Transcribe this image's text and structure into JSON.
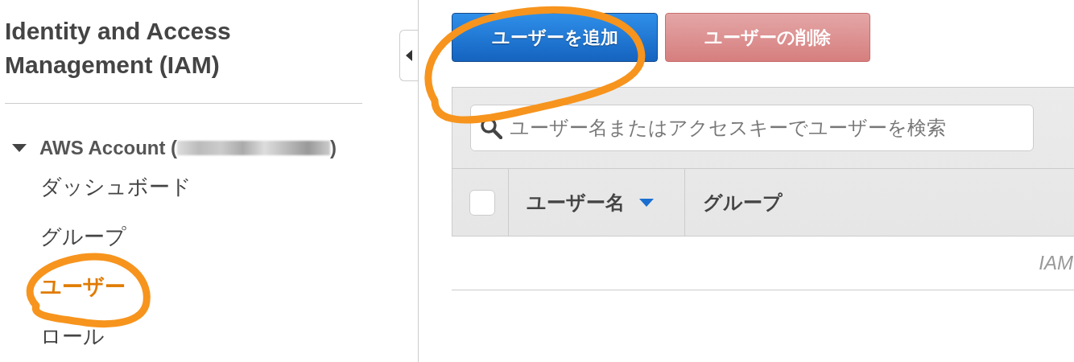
{
  "sidebar": {
    "title": "Identity and Access Management (IAM)",
    "account": {
      "label_start": "AWS Account (",
      "label_end": ")",
      "expanded": true
    },
    "items": [
      {
        "label": "ダッシュボード",
        "selected": false
      },
      {
        "label": "グループ",
        "selected": false
      },
      {
        "label": "ユーザー",
        "selected": true
      },
      {
        "label": "ロール",
        "selected": false
      }
    ]
  },
  "toolbar": {
    "buttons": [
      {
        "label": "ユーザーを追加",
        "kind": "primary"
      },
      {
        "label": "ユーザーの削除",
        "kind": "danger"
      }
    ]
  },
  "search": {
    "placeholder": "ユーザー名またはアクセスキーでユーザーを検索"
  },
  "table": {
    "select_all": {
      "checked": false
    },
    "columns": [
      {
        "label": "ユーザー名",
        "sorted": true
      },
      {
        "label": "グループ",
        "sorted": false
      }
    ]
  },
  "footer_text": "IAM"
}
